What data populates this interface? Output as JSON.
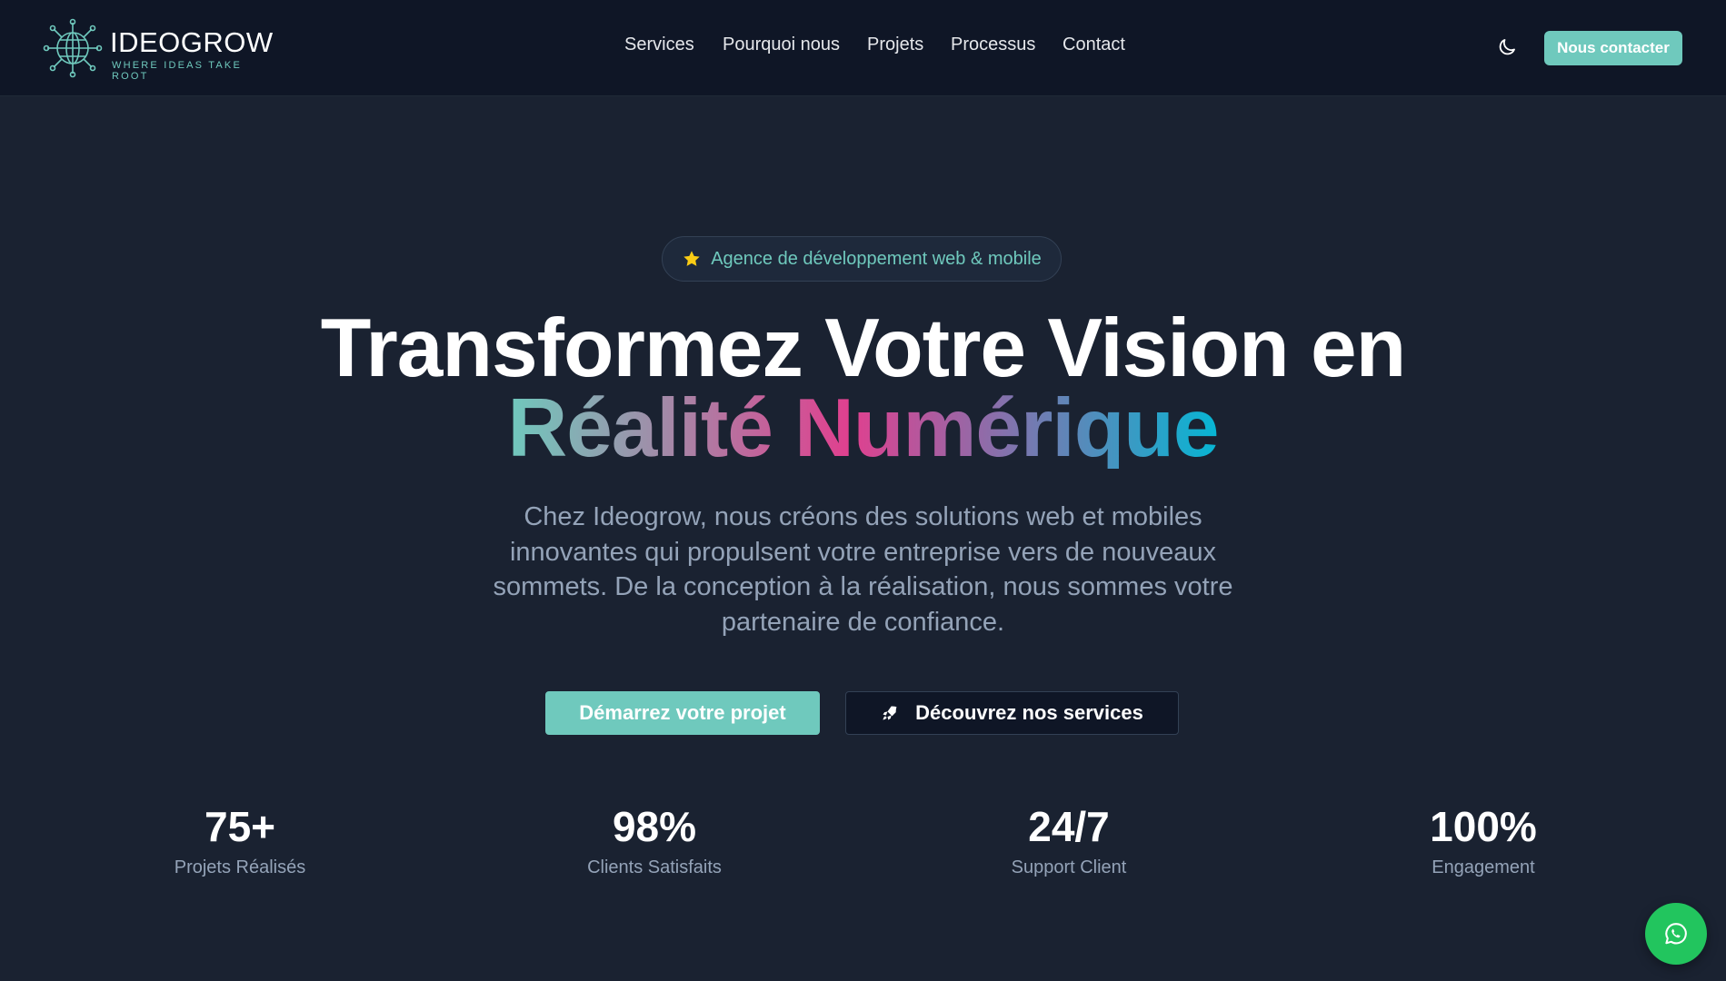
{
  "header": {
    "brand_name": "IDEOGROW",
    "brand_tagline": "WHERE IDEAS TAKE ROOT",
    "nav": [
      {
        "label": "Services"
      },
      {
        "label": "Pourquoi nous"
      },
      {
        "label": "Projets"
      },
      {
        "label": "Processus"
      },
      {
        "label": "Contact"
      }
    ],
    "theme_icon": "moon-icon",
    "contact_button": "Nous contacter"
  },
  "hero": {
    "badge_icon": "star-icon",
    "badge_text": "Agence de développement web & mobile",
    "title_line1": "Transformez Votre Vision en",
    "title_line2": "Réalité Numérique",
    "description": "Chez Ideogrow, nous créons des solutions web et mobiles innovantes qui propulsent votre entreprise vers de nouveaux sommets. De la conception à la réalisation, nous sommes votre partenaire de confiance.",
    "primary_cta": "Démarrez votre projet",
    "secondary_cta": "Découvrez nos services",
    "secondary_cta_icon": "rocket-icon"
  },
  "stats": [
    {
      "value": "75+",
      "label": "Projets Réalisés"
    },
    {
      "value": "98%",
      "label": "Clients Satisfaits"
    },
    {
      "value": "24/7",
      "label": "Support Client"
    },
    {
      "value": "100%",
      "label": "Engagement"
    }
  ],
  "floating": {
    "whatsapp_icon": "whatsapp-icon"
  },
  "colors": {
    "accent": "#6fc9bd",
    "background": "#1a2231",
    "header_background": "#0f1626",
    "whatsapp": "#22c55e",
    "gradient_mid": "#e0408f",
    "gradient_end": "#06b6d4"
  }
}
